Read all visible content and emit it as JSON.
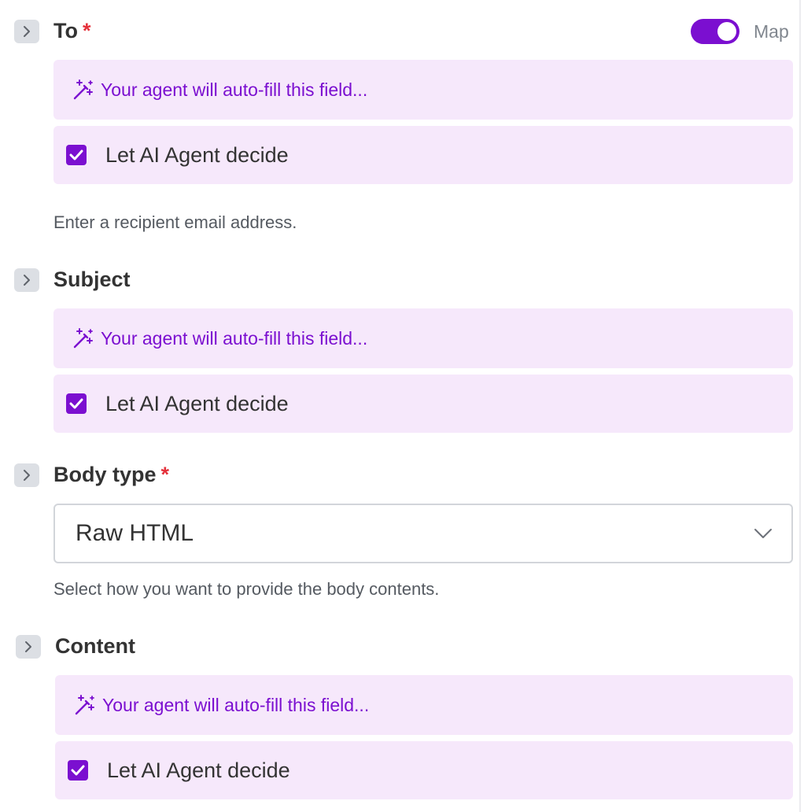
{
  "fields": [
    {
      "label": "To",
      "required": true,
      "ai_placeholder": "Your agent will auto-fill this field...",
      "checkbox_label": "Let AI Agent decide",
      "checked": true,
      "helper": "Enter a recipient email address."
    },
    {
      "label": "Subject",
      "required": false,
      "ai_placeholder": "Your agent will auto-fill this field...",
      "checkbox_label": "Let AI Agent decide",
      "checked": true
    },
    {
      "label": "Body type",
      "required": true,
      "select_value": "Raw HTML",
      "helper": "Select how you want to provide the body contents."
    },
    {
      "label": "Content",
      "required": false,
      "ai_placeholder": "Your agent will auto-fill this field...",
      "checkbox_label": "Let AI Agent decide",
      "checked": true
    }
  ],
  "map_toggle": {
    "label": "Map",
    "on": true
  },
  "required_marker": "*",
  "colors": {
    "accent": "#7b0fd0",
    "ai_background": "#f6e8fb",
    "required": "#e4313b",
    "text": "#333333",
    "helper": "#555a61"
  },
  "icons": {
    "expander": "chevron-right-icon",
    "ai": "magic-wand-icon",
    "check": "checkmark-icon",
    "select": "chevron-down-icon"
  }
}
